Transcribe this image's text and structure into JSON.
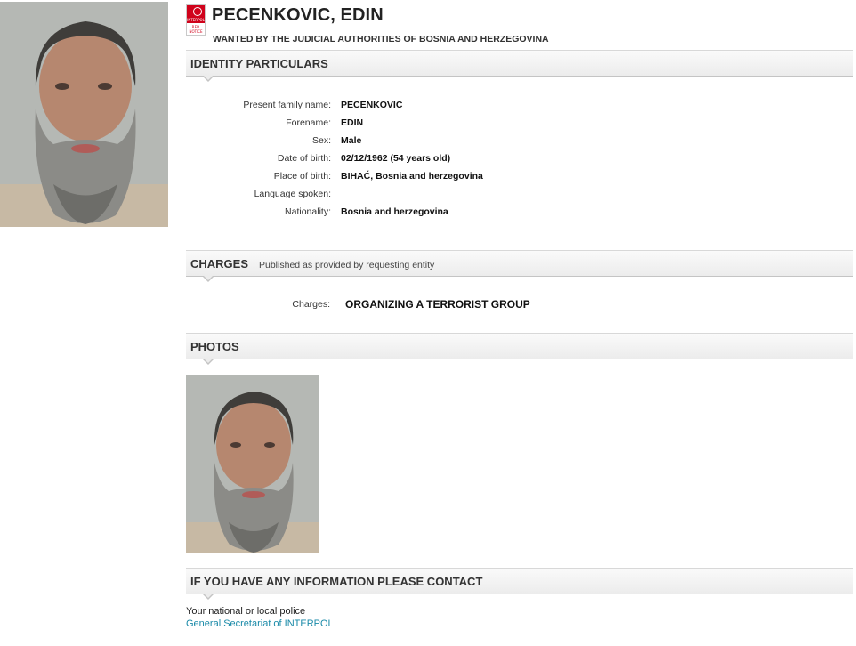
{
  "header": {
    "name": "PECENKOVIC, EDIN",
    "wanted_by": "WANTED BY THE JUDICIAL AUTHORITIES OF BOSNIA AND HERZEGOVINA",
    "notice_icon": {
      "name": "red-notice-icon",
      "top_text": "INTERPOL",
      "bottom_text": "RED NOTICE",
      "color": "#d0021b"
    }
  },
  "identity": {
    "title": "IDENTITY PARTICULARS",
    "fields": [
      {
        "label": "Present family name:",
        "value": "PECENKOVIC"
      },
      {
        "label": "Forename:",
        "value": "EDIN"
      },
      {
        "label": "Sex:",
        "value": "Male"
      },
      {
        "label": "Date of birth:",
        "value": "02/12/1962 (54 years old)"
      },
      {
        "label": "Place of birth:",
        "value": "BIHAĆ, Bosnia and herzegovina"
      },
      {
        "label": "Language spoken:",
        "value": ""
      },
      {
        "label": "Nationality:",
        "value": "Bosnia and herzegovina"
      }
    ]
  },
  "charges": {
    "title": "CHARGES",
    "subtitle": "Published as provided by requesting entity",
    "label": "Charges:",
    "value": "ORGANIZING A TERRORIST GROUP"
  },
  "photos": {
    "title": "PHOTOS"
  },
  "contact": {
    "title": "IF YOU HAVE ANY INFORMATION PLEASE CONTACT",
    "line1": "Your national or local police",
    "link": "General Secretariat of INTERPOL"
  },
  "colors": {
    "accent": "#d0021b",
    "link": "#1a8aa8"
  }
}
